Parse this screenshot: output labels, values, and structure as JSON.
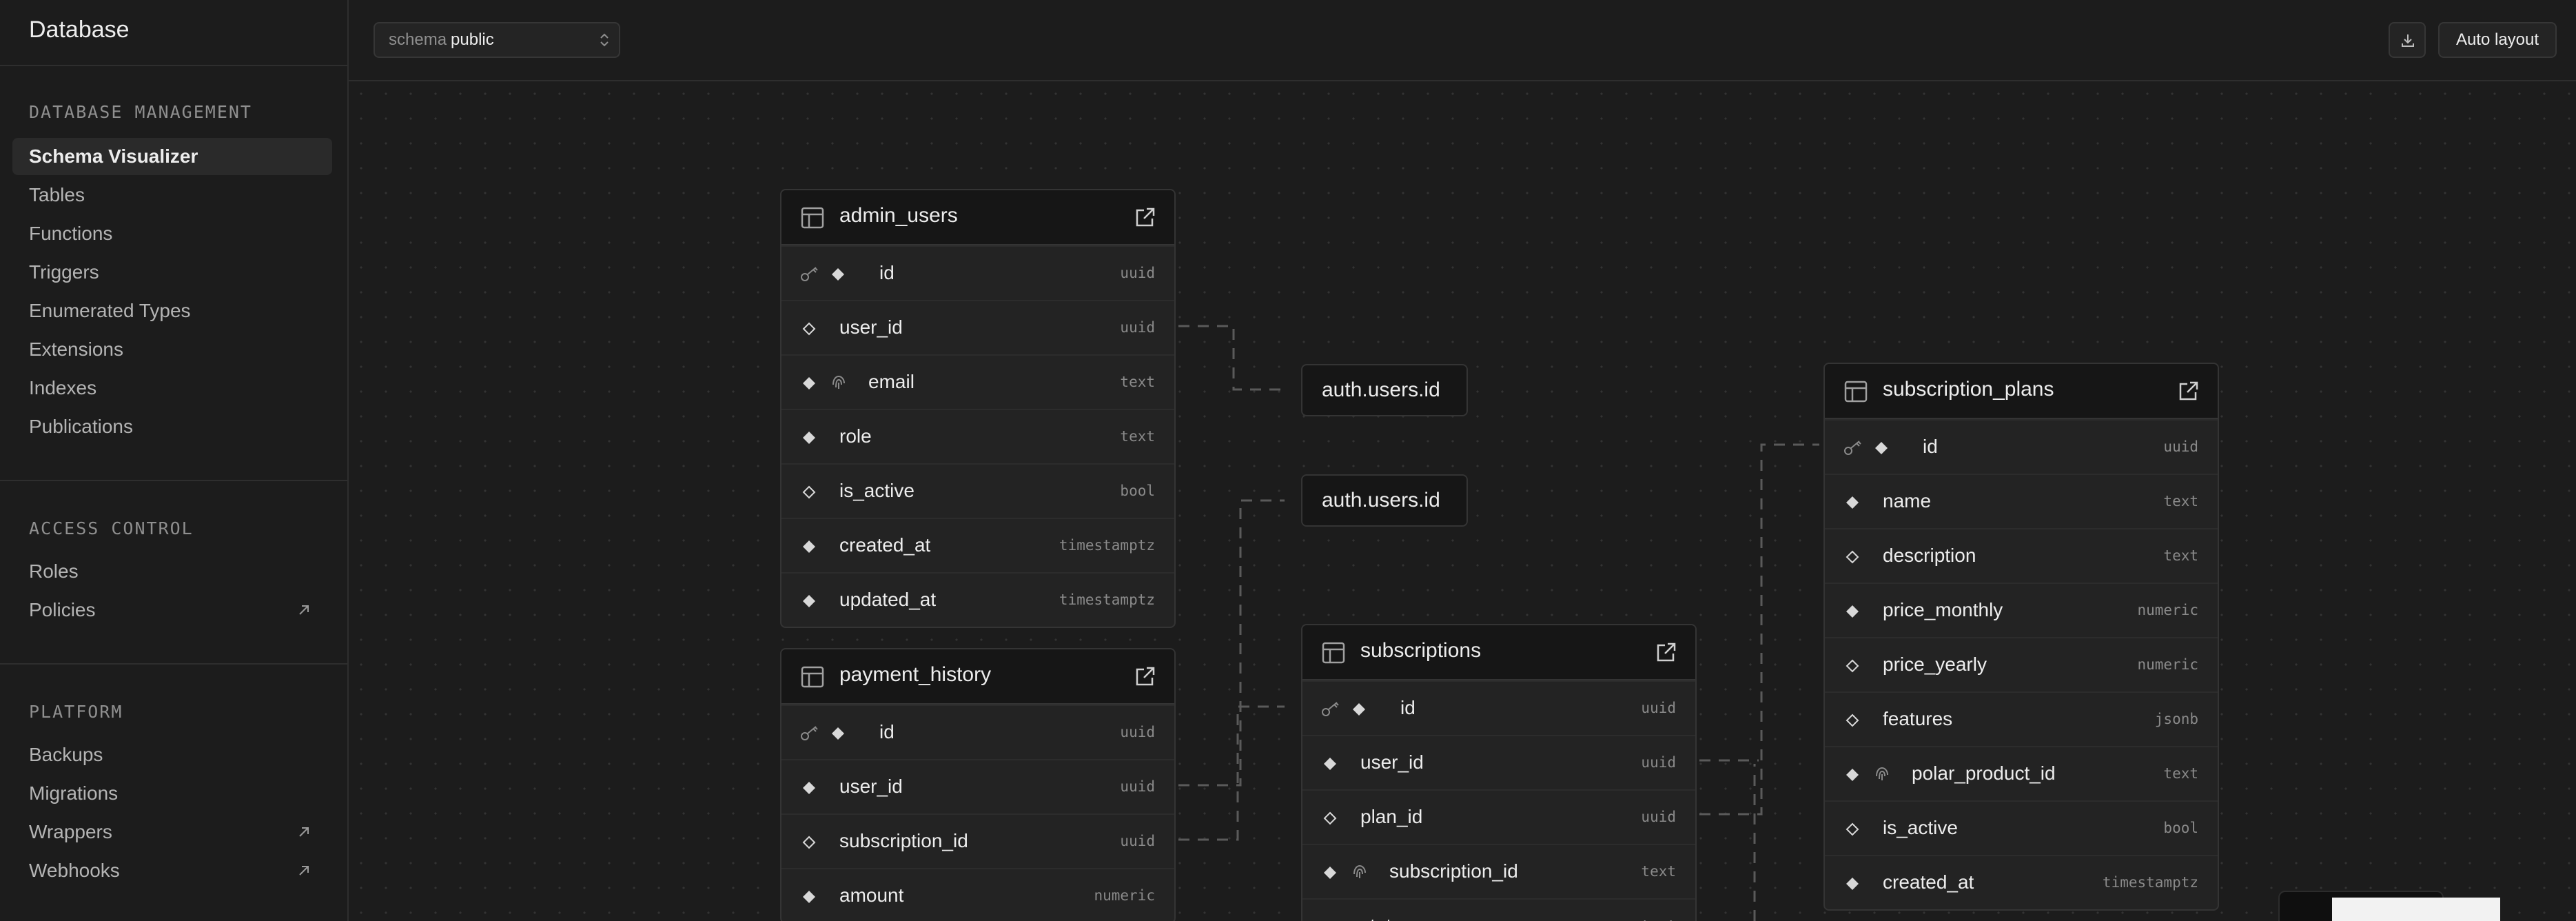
{
  "sidebar": {
    "title": "Database",
    "sections": [
      {
        "heading": "DATABASE MANAGEMENT",
        "items": [
          {
            "label": "Schema Visualizer",
            "active": true
          },
          {
            "label": "Tables"
          },
          {
            "label": "Functions"
          },
          {
            "label": "Triggers"
          },
          {
            "label": "Enumerated Types"
          },
          {
            "label": "Extensions"
          },
          {
            "label": "Indexes"
          },
          {
            "label": "Publications"
          }
        ]
      },
      {
        "heading": "ACCESS CONTROL",
        "items": [
          {
            "label": "Roles"
          },
          {
            "label": "Policies",
            "external": true
          }
        ]
      },
      {
        "heading": "PLATFORM",
        "items": [
          {
            "label": "Backups"
          },
          {
            "label": "Migrations"
          },
          {
            "label": "Wrappers",
            "external": true
          },
          {
            "label": "Webhooks",
            "external": true
          }
        ]
      }
    ]
  },
  "toolbar": {
    "schema_label": "schema",
    "schema_value": "public",
    "auto_layout_label": "Auto layout",
    "download_icon": "download-icon"
  },
  "canvas": {
    "tables": [
      {
        "name": "admin_users",
        "columns": [
          {
            "name": "id",
            "type": "uuid",
            "pk": true
          },
          {
            "name": "user_id",
            "type": "uuid",
            "nullable": true
          },
          {
            "name": "email",
            "type": "text",
            "unique": true
          },
          {
            "name": "role",
            "type": "text"
          },
          {
            "name": "is_active",
            "type": "bool",
            "nullable": true
          },
          {
            "name": "created_at",
            "type": "timestamptz"
          },
          {
            "name": "updated_at",
            "type": "timestamptz"
          }
        ]
      },
      {
        "name": "payment_history",
        "columns": [
          {
            "name": "id",
            "type": "uuid",
            "pk": true
          },
          {
            "name": "user_id",
            "type": "uuid"
          },
          {
            "name": "subscription_id",
            "type": "uuid",
            "nullable": true
          },
          {
            "name": "amount",
            "type": "numeric"
          }
        ]
      },
      {
        "name": "subscriptions",
        "columns": [
          {
            "name": "id",
            "type": "uuid",
            "pk": true
          },
          {
            "name": "user_id",
            "type": "uuid"
          },
          {
            "name": "plan_id",
            "type": "uuid",
            "nullable": true
          },
          {
            "name": "subscription_id",
            "type": "text",
            "unique": true
          },
          {
            "name": "status",
            "type": "text"
          }
        ]
      },
      {
        "name": "subscription_plans",
        "columns": [
          {
            "name": "id",
            "type": "uuid",
            "pk": true
          },
          {
            "name": "name",
            "type": "text"
          },
          {
            "name": "description",
            "type": "text",
            "nullable": true
          },
          {
            "name": "price_monthly",
            "type": "numeric"
          },
          {
            "name": "price_yearly",
            "type": "numeric",
            "nullable": true
          },
          {
            "name": "features",
            "type": "jsonb",
            "nullable": true
          },
          {
            "name": "polar_product_id",
            "type": "text",
            "unique": true
          },
          {
            "name": "is_active",
            "type": "bool",
            "nullable": true
          },
          {
            "name": "created_at",
            "type": "timestamptz"
          }
        ]
      }
    ],
    "references": [
      {
        "label": "auth.users.id"
      },
      {
        "label": "auth.users.id"
      }
    ]
  }
}
